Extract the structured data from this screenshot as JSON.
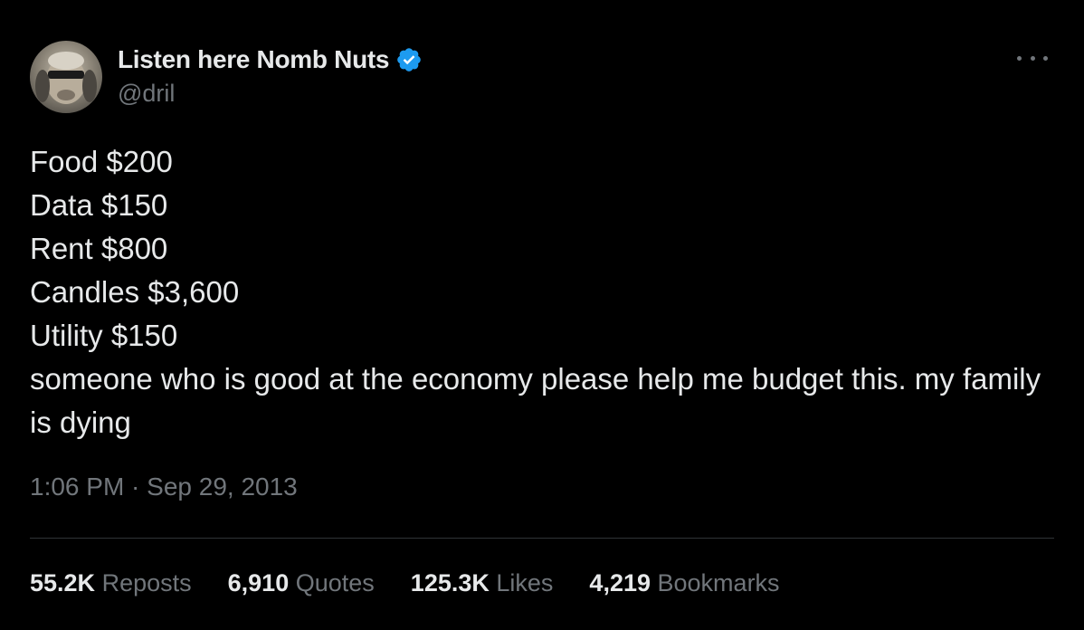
{
  "author": {
    "display_name": "Listen here Nomb Nuts",
    "handle": "@dril",
    "verified_icon": "verified-badge-icon",
    "verified_color": "#1d9bf0"
  },
  "menu": {
    "icon": "more-options-icon"
  },
  "tweet": {
    "lines": [
      "Food $200",
      "Data $150",
      "Rent $800",
      "Candles $3,600",
      "Utility $150",
      "someone who is good at the economy please help me budget this. my family is dying"
    ],
    "timestamp": "1:06 PM · Sep 29, 2013"
  },
  "stats": [
    {
      "count": "55.2K",
      "label": "Reposts"
    },
    {
      "count": "6,910",
      "label": "Quotes"
    },
    {
      "count": "125.3K",
      "label": "Likes"
    },
    {
      "count": "4,219",
      "label": "Bookmarks"
    }
  ],
  "colors": {
    "background": "#000000",
    "text_primary": "#e7e9ea",
    "text_secondary": "#71767b",
    "divider": "#2f3336"
  }
}
